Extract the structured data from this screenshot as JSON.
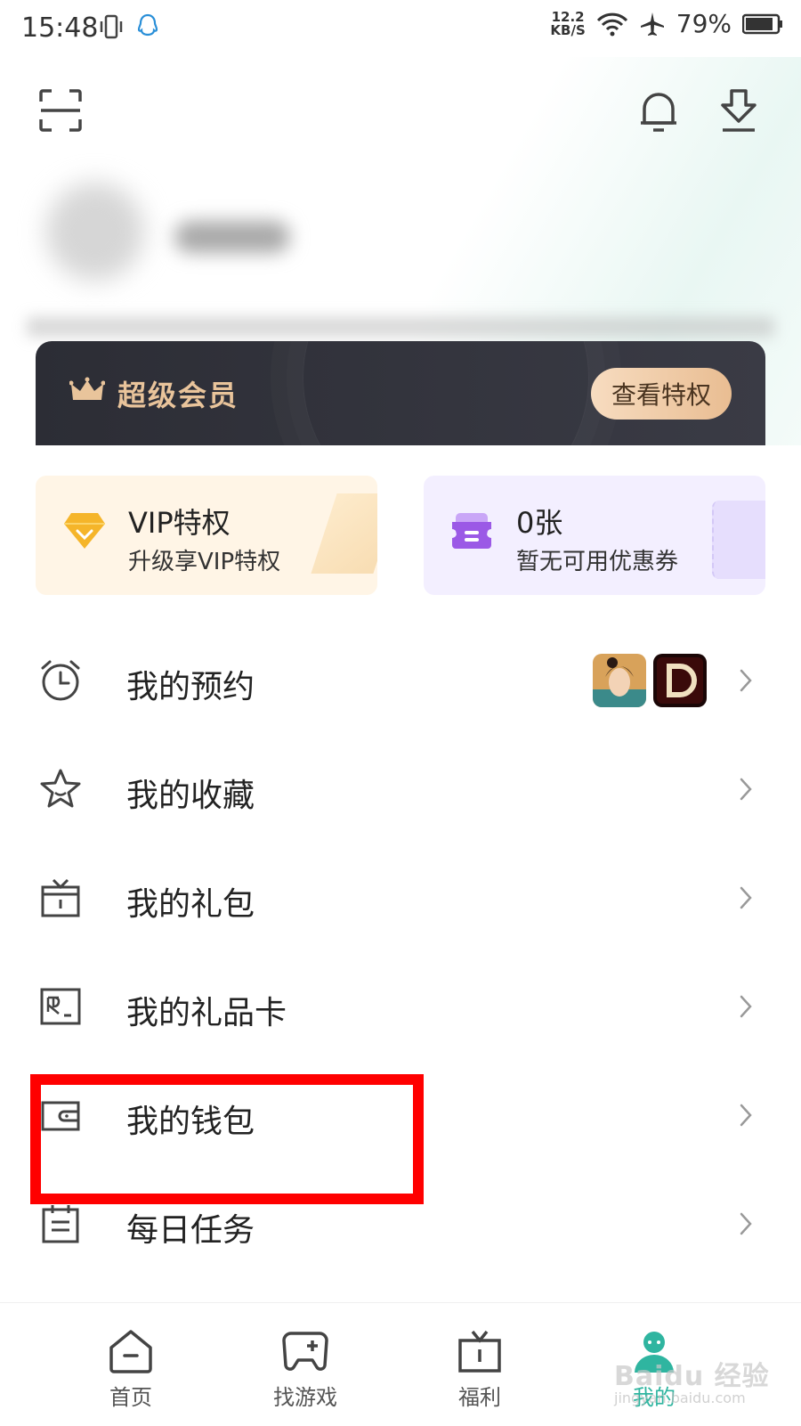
{
  "status_bar": {
    "time": "15:48",
    "net_speed_value": "12.2",
    "net_speed_unit": "KB/S",
    "battery": "79%"
  },
  "vip_banner": {
    "title": "超级会员",
    "button_label": "查看特权"
  },
  "promo": {
    "vip_title": "VIP特权",
    "vip_subtitle": "升级享VIP特权",
    "coupon_title": "0张",
    "coupon_subtitle": "暂无可用优惠券"
  },
  "menu": {
    "reservations": "我的预约",
    "favorites": "我的收藏",
    "gift_packs": "我的礼包",
    "gift_cards": "我的礼品卡",
    "wallet": "我的钱包",
    "daily_tasks": "每日任务"
  },
  "tabs": {
    "home": "首页",
    "find_games": "找游戏",
    "welfare": "福利",
    "mine": "我的"
  },
  "watermark": {
    "brand": "Baidu 经验",
    "url": "jingyan.baidu.com"
  },
  "colors": {
    "accent": "#2fb5a0",
    "vip_gold": "#e9c49b",
    "highlight_red": "#ff0000"
  }
}
